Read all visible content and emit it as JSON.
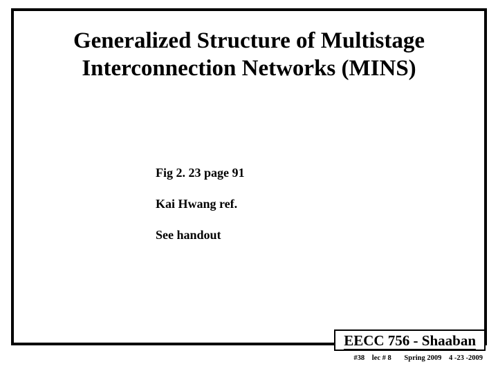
{
  "title_line1": "Generalized Structure of Multistage",
  "title_line2": "Interconnection Networks (MINS)",
  "body": {
    "fig": "Fig 2. 23  page 91",
    "ref": "Kai Hwang ref.",
    "handout": "See handout"
  },
  "footer": {
    "course": "EECC 756 - Shaaban",
    "slide_no": "#38",
    "lecture": "lec # 8",
    "term": "Spring 2009",
    "date": "4 -23 -2009"
  }
}
